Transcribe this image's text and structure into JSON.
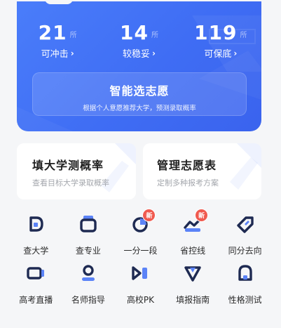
{
  "stats": [
    {
      "value": "21",
      "unit": "所",
      "label": "可冲击"
    },
    {
      "value": "14",
      "unit": "所",
      "label": "较稳妥"
    },
    {
      "value": "119",
      "unit": "所",
      "label": "可保底"
    }
  ],
  "smart": {
    "title": "智能选志愿",
    "subtitle": "根据个人意愿推荐大学，预测录取概率"
  },
  "cards": {
    "left": {
      "title": "填大学测概率",
      "subtitle": "查看目标大学录取概率"
    },
    "right": {
      "title": "管理志愿表",
      "subtitle": "定制多种报考方案"
    }
  },
  "grid": {
    "badge_label": "新",
    "row1": [
      {
        "label": "查大学",
        "icon": "university-icon"
      },
      {
        "label": "查专业",
        "icon": "major-icon"
      },
      {
        "label": "一分一段",
        "icon": "score-segment-icon",
        "badge": true
      },
      {
        "label": "省控线",
        "icon": "province-line-icon",
        "badge": true
      },
      {
        "label": "同分去向",
        "icon": "same-score-icon"
      }
    ],
    "row2": [
      {
        "label": "高考直播",
        "icon": "live-icon"
      },
      {
        "label": "名师指导",
        "icon": "teacher-icon"
      },
      {
        "label": "高校PK",
        "icon": "pk-icon"
      },
      {
        "label": "填报指南",
        "icon": "guide-icon"
      },
      {
        "label": "性格测试",
        "icon": "personality-test-icon"
      }
    ]
  },
  "colors": {
    "primary": "#4a7dfa",
    "icon_dark": "#1e2a52",
    "icon_accent": "#5b83f7",
    "badge": "#f05a4f"
  }
}
